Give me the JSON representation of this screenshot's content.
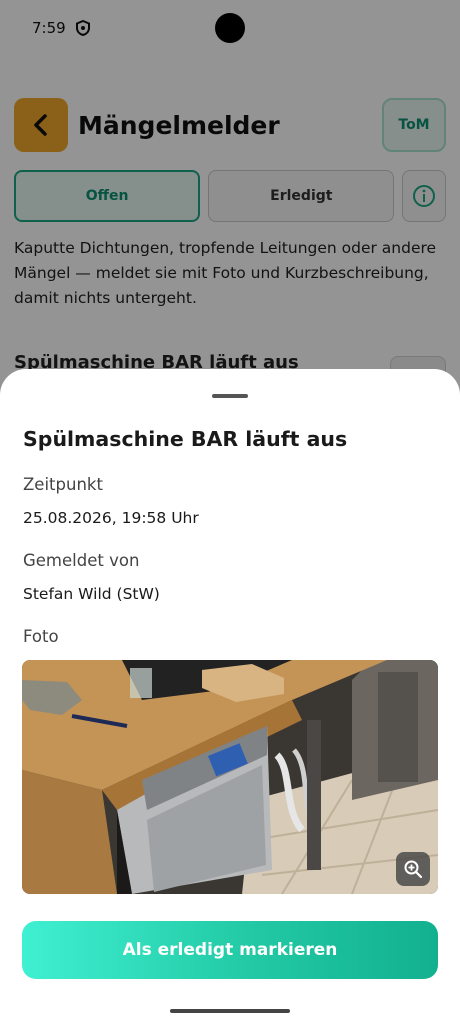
{
  "status_bar": {
    "time": "7:59"
  },
  "header": {
    "title": "Mängelmelder",
    "user_initials": "ToM"
  },
  "tabs": [
    {
      "label": "Offen",
      "active": true
    },
    {
      "label": "Erledigt",
      "active": false
    }
  ],
  "intro_text": "Kaputte Dichtungen, tropfende Leitungen oder andere Mängel — meldet sie mit Foto und Kurzbeschreibung, damit nichts untergeht.",
  "list_peek_title": "Spülmaschine BAR läuft aus",
  "sheet": {
    "title": "Spülmaschine BAR läuft aus",
    "time_label": "Zeitpunkt",
    "time_value": "25.08.2026, 19:58 Uhr",
    "reporter_label": "Gemeldet von",
    "reporter_value": "Stefan Wild (StW)",
    "photo_label": "Foto",
    "action_label": "Als erledigt markieren"
  },
  "colors": {
    "accent": "#1da883",
    "back_button": "#f0a52a",
    "cta_start": "#3ff0d2",
    "cta_end": "#12b08f"
  },
  "icons": {
    "back": "chevron-left-icon",
    "info": "info-icon",
    "zoom": "zoom-in-icon",
    "shield": "shield-icon",
    "signal": "signal-icon",
    "wifi": "wifi-icon",
    "battery": "battery-icon"
  }
}
